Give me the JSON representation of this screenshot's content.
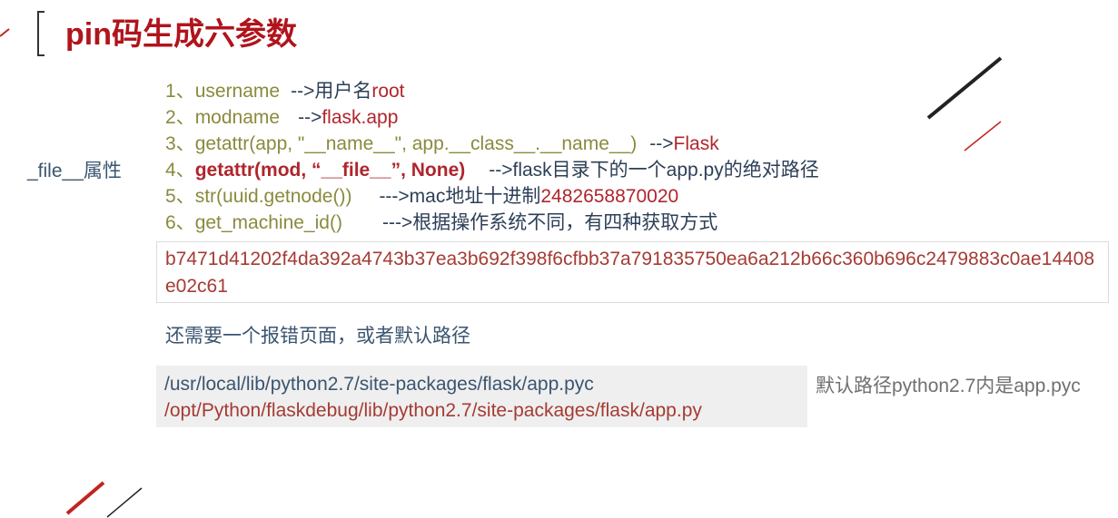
{
  "title": "pin码生成六参数",
  "side_label": "_file__属性",
  "params": [
    {
      "num": "1、",
      "text": "username",
      "arrow": "-->用户名",
      "result": "root"
    },
    {
      "num": "2、",
      "text": "modname",
      "arrow": "-->",
      "result": "flask.app"
    },
    {
      "num": "3、",
      "text": "getattr(app, \"__name__\", app.__class__.__name__)",
      "arrow": "-->",
      "result": "Flask"
    },
    {
      "num": "4、",
      "text": "getattr(mod, “__file__”, None)",
      "arrow": "-->flask目录下的一个app.py的绝对路径",
      "result": ""
    },
    {
      "num": "5、",
      "text": "str(uuid.getnode())",
      "arrow": "--->mac地址十进制",
      "result": "2482658870020"
    },
    {
      "num": "6、",
      "text": "get_machine_id()",
      "arrow": "--->根据操作系统不同，有四种获取方式",
      "result": ""
    }
  ],
  "machine_id": "b7471d41202f4da392a4743b37ea3b692f398f6cfbb37a791835750ea6a212b66c360b696c2479883c0ae14408e02c61",
  "need_text": "还需要一个报错页面，或者默认路径",
  "paths": [
    "/usr/local/lib/python2.7/site-packages/flask/app.pyc",
    "/opt/Python/flaskdebug/lib/python2.7/site-packages/flask/app.py"
  ],
  "note": "默认路径python2.7内是app.pyc",
  "colors": {
    "title": "#b0141c",
    "result": "#b0252c",
    "text": "#3b5570",
    "number": "#8a8a3e"
  }
}
